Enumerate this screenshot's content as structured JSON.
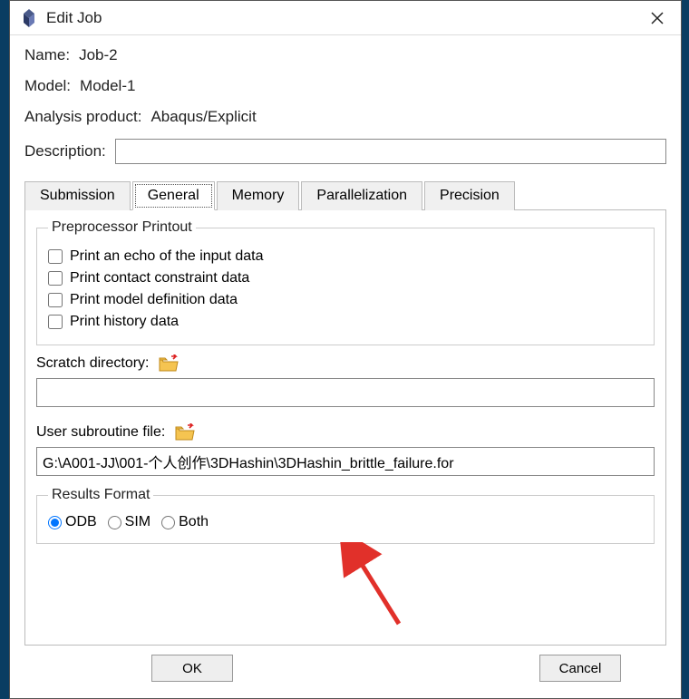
{
  "window": {
    "title": "Edit Job"
  },
  "fields": {
    "name_label": "Name:",
    "name_value": "Job-2",
    "model_label": "Model:",
    "model_value": "Model-1",
    "analysis_label": "Analysis product:",
    "analysis_value": "Abaqus/Explicit",
    "description_label": "Description:",
    "description_value": ""
  },
  "tabs": {
    "submission": "Submission",
    "general": "General",
    "memory": "Memory",
    "parallel": "Parallelization",
    "precision": "Precision"
  },
  "preproc": {
    "legend": "Preprocessor Printout",
    "echo": "Print an echo of the input data",
    "contact": "Print contact constraint data",
    "modeldef": "Print model definition data",
    "history": "Print history data"
  },
  "scratch": {
    "label": "Scratch directory:",
    "value": ""
  },
  "subroutine": {
    "label": "User subroutine file:",
    "value": "G:\\A001-JJ\\001-个人创作\\3DHashin\\3DHashin_brittle_failure.for"
  },
  "results": {
    "legend": "Results Format",
    "odb": "ODB",
    "sim": "SIM",
    "both": "Both"
  },
  "buttons": {
    "ok": "OK",
    "cancel": "Cancel"
  }
}
